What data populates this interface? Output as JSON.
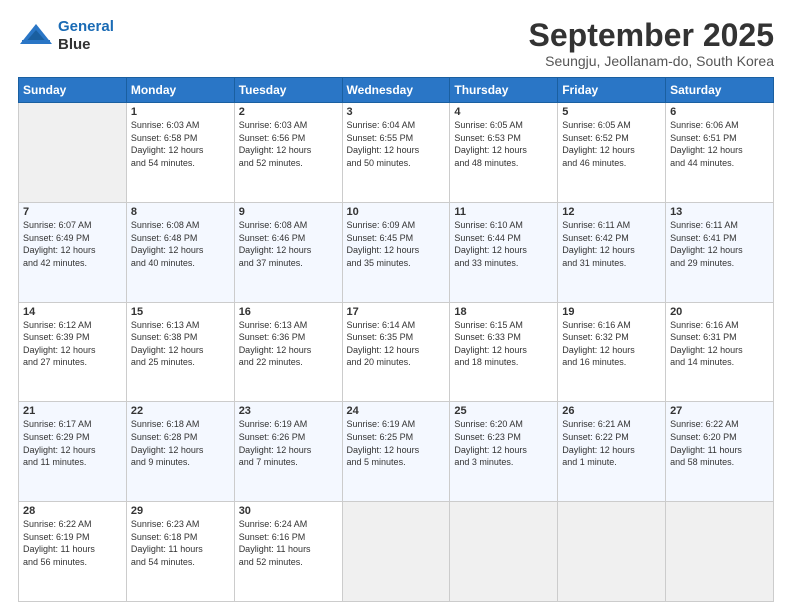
{
  "header": {
    "logo_line1": "General",
    "logo_line2": "Blue",
    "title": "September 2025",
    "subtitle": "Seungju, Jeollanam-do, South Korea"
  },
  "days": [
    "Sunday",
    "Monday",
    "Tuesday",
    "Wednesday",
    "Thursday",
    "Friday",
    "Saturday"
  ],
  "weeks": [
    [
      {
        "num": "",
        "info": ""
      },
      {
        "num": "1",
        "info": "Sunrise: 6:03 AM\nSunset: 6:58 PM\nDaylight: 12 hours\nand 54 minutes."
      },
      {
        "num": "2",
        "info": "Sunrise: 6:03 AM\nSunset: 6:56 PM\nDaylight: 12 hours\nand 52 minutes."
      },
      {
        "num": "3",
        "info": "Sunrise: 6:04 AM\nSunset: 6:55 PM\nDaylight: 12 hours\nand 50 minutes."
      },
      {
        "num": "4",
        "info": "Sunrise: 6:05 AM\nSunset: 6:53 PM\nDaylight: 12 hours\nand 48 minutes."
      },
      {
        "num": "5",
        "info": "Sunrise: 6:05 AM\nSunset: 6:52 PM\nDaylight: 12 hours\nand 46 minutes."
      },
      {
        "num": "6",
        "info": "Sunrise: 6:06 AM\nSunset: 6:51 PM\nDaylight: 12 hours\nand 44 minutes."
      }
    ],
    [
      {
        "num": "7",
        "info": "Sunrise: 6:07 AM\nSunset: 6:49 PM\nDaylight: 12 hours\nand 42 minutes."
      },
      {
        "num": "8",
        "info": "Sunrise: 6:08 AM\nSunset: 6:48 PM\nDaylight: 12 hours\nand 40 minutes."
      },
      {
        "num": "9",
        "info": "Sunrise: 6:08 AM\nSunset: 6:46 PM\nDaylight: 12 hours\nand 37 minutes."
      },
      {
        "num": "10",
        "info": "Sunrise: 6:09 AM\nSunset: 6:45 PM\nDaylight: 12 hours\nand 35 minutes."
      },
      {
        "num": "11",
        "info": "Sunrise: 6:10 AM\nSunset: 6:44 PM\nDaylight: 12 hours\nand 33 minutes."
      },
      {
        "num": "12",
        "info": "Sunrise: 6:11 AM\nSunset: 6:42 PM\nDaylight: 12 hours\nand 31 minutes."
      },
      {
        "num": "13",
        "info": "Sunrise: 6:11 AM\nSunset: 6:41 PM\nDaylight: 12 hours\nand 29 minutes."
      }
    ],
    [
      {
        "num": "14",
        "info": "Sunrise: 6:12 AM\nSunset: 6:39 PM\nDaylight: 12 hours\nand 27 minutes."
      },
      {
        "num": "15",
        "info": "Sunrise: 6:13 AM\nSunset: 6:38 PM\nDaylight: 12 hours\nand 25 minutes."
      },
      {
        "num": "16",
        "info": "Sunrise: 6:13 AM\nSunset: 6:36 PM\nDaylight: 12 hours\nand 22 minutes."
      },
      {
        "num": "17",
        "info": "Sunrise: 6:14 AM\nSunset: 6:35 PM\nDaylight: 12 hours\nand 20 minutes."
      },
      {
        "num": "18",
        "info": "Sunrise: 6:15 AM\nSunset: 6:33 PM\nDaylight: 12 hours\nand 18 minutes."
      },
      {
        "num": "19",
        "info": "Sunrise: 6:16 AM\nSunset: 6:32 PM\nDaylight: 12 hours\nand 16 minutes."
      },
      {
        "num": "20",
        "info": "Sunrise: 6:16 AM\nSunset: 6:31 PM\nDaylight: 12 hours\nand 14 minutes."
      }
    ],
    [
      {
        "num": "21",
        "info": "Sunrise: 6:17 AM\nSunset: 6:29 PM\nDaylight: 12 hours\nand 11 minutes."
      },
      {
        "num": "22",
        "info": "Sunrise: 6:18 AM\nSunset: 6:28 PM\nDaylight: 12 hours\nand 9 minutes."
      },
      {
        "num": "23",
        "info": "Sunrise: 6:19 AM\nSunset: 6:26 PM\nDaylight: 12 hours\nand 7 minutes."
      },
      {
        "num": "24",
        "info": "Sunrise: 6:19 AM\nSunset: 6:25 PM\nDaylight: 12 hours\nand 5 minutes."
      },
      {
        "num": "25",
        "info": "Sunrise: 6:20 AM\nSunset: 6:23 PM\nDaylight: 12 hours\nand 3 minutes."
      },
      {
        "num": "26",
        "info": "Sunrise: 6:21 AM\nSunset: 6:22 PM\nDaylight: 12 hours\nand 1 minute."
      },
      {
        "num": "27",
        "info": "Sunrise: 6:22 AM\nSunset: 6:20 PM\nDaylight: 11 hours\nand 58 minutes."
      }
    ],
    [
      {
        "num": "28",
        "info": "Sunrise: 6:22 AM\nSunset: 6:19 PM\nDaylight: 11 hours\nand 56 minutes."
      },
      {
        "num": "29",
        "info": "Sunrise: 6:23 AM\nSunset: 6:18 PM\nDaylight: 11 hours\nand 54 minutes."
      },
      {
        "num": "30",
        "info": "Sunrise: 6:24 AM\nSunset: 6:16 PM\nDaylight: 11 hours\nand 52 minutes."
      },
      {
        "num": "",
        "info": ""
      },
      {
        "num": "",
        "info": ""
      },
      {
        "num": "",
        "info": ""
      },
      {
        "num": "",
        "info": ""
      }
    ]
  ]
}
